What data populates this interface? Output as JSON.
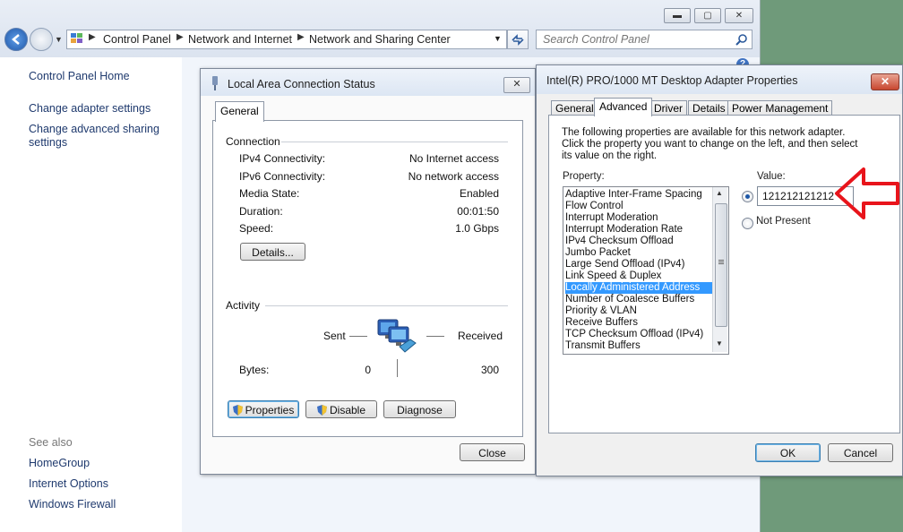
{
  "explorer": {
    "caption_buttons": {
      "minimize": "▬",
      "maximize": "▢",
      "close": "✕"
    },
    "breadcrumb": [
      "Control Panel",
      "Network and Internet",
      "Network and Sharing Center"
    ],
    "search_placeholder": "Search Control Panel",
    "left_nav": {
      "home": "Control Panel Home",
      "items": [
        "Change adapter settings",
        "Change advanced sharing settings"
      ],
      "see_also_title": "See also",
      "see_also": [
        "HomeGroup",
        "Internet Options",
        "Windows Firewall"
      ]
    }
  },
  "status_dialog": {
    "title": "Local Area Connection Status",
    "tab": "General",
    "connection_title": "Connection",
    "rows": [
      {
        "label": "IPv4 Connectivity:",
        "value": "No Internet access"
      },
      {
        "label": "IPv6 Connectivity:",
        "value": "No network access"
      },
      {
        "label": "Media State:",
        "value": "Enabled"
      },
      {
        "label": "Duration:",
        "value": "00:01:50"
      },
      {
        "label": "Speed:",
        "value": "1.0 Gbps"
      }
    ],
    "details_button": "Details...",
    "activity_title": "Activity",
    "sent_label": "Sent",
    "received_label": "Received",
    "bytes_label": "Bytes:",
    "bytes_sent": "0",
    "bytes_received": "300",
    "buttons": {
      "properties": "Properties",
      "disable": "Disable",
      "diagnose": "Diagnose",
      "close": "Close"
    }
  },
  "adapter_dialog": {
    "title": "Intel(R) PRO/1000 MT Desktop Adapter Properties",
    "tabs": [
      "General",
      "Advanced",
      "Driver",
      "Details",
      "Power Management"
    ],
    "selected_tab": "Advanced",
    "description": "The following properties are available for this network adapter. Click the property you want to change on the left, and then select its value on the right.",
    "property_label": "Property:",
    "value_label": "Value:",
    "properties": [
      "Adaptive Inter-Frame Spacing",
      "Flow Control",
      "Interrupt Moderation",
      "Interrupt Moderation Rate",
      "IPv4 Checksum Offload",
      "Jumbo Packet",
      "Large Send Offload (IPv4)",
      "Link Speed & Duplex",
      "Locally Administered Address",
      "Number of Coalesce Buffers",
      "Priority & VLAN",
      "Receive Buffers",
      "TCP Checksum Offload (IPv4)",
      "Transmit Buffers"
    ],
    "selected_property": "Locally Administered Address",
    "value": "121212121212",
    "not_present_label": "Not Present",
    "buttons": {
      "ok": "OK",
      "cancel": "Cancel"
    },
    "close_glyph": "✕"
  },
  "colors": {
    "annotation_arrow": "#e8141b",
    "selection": "#3399ff",
    "link": "#1f3a6e"
  }
}
